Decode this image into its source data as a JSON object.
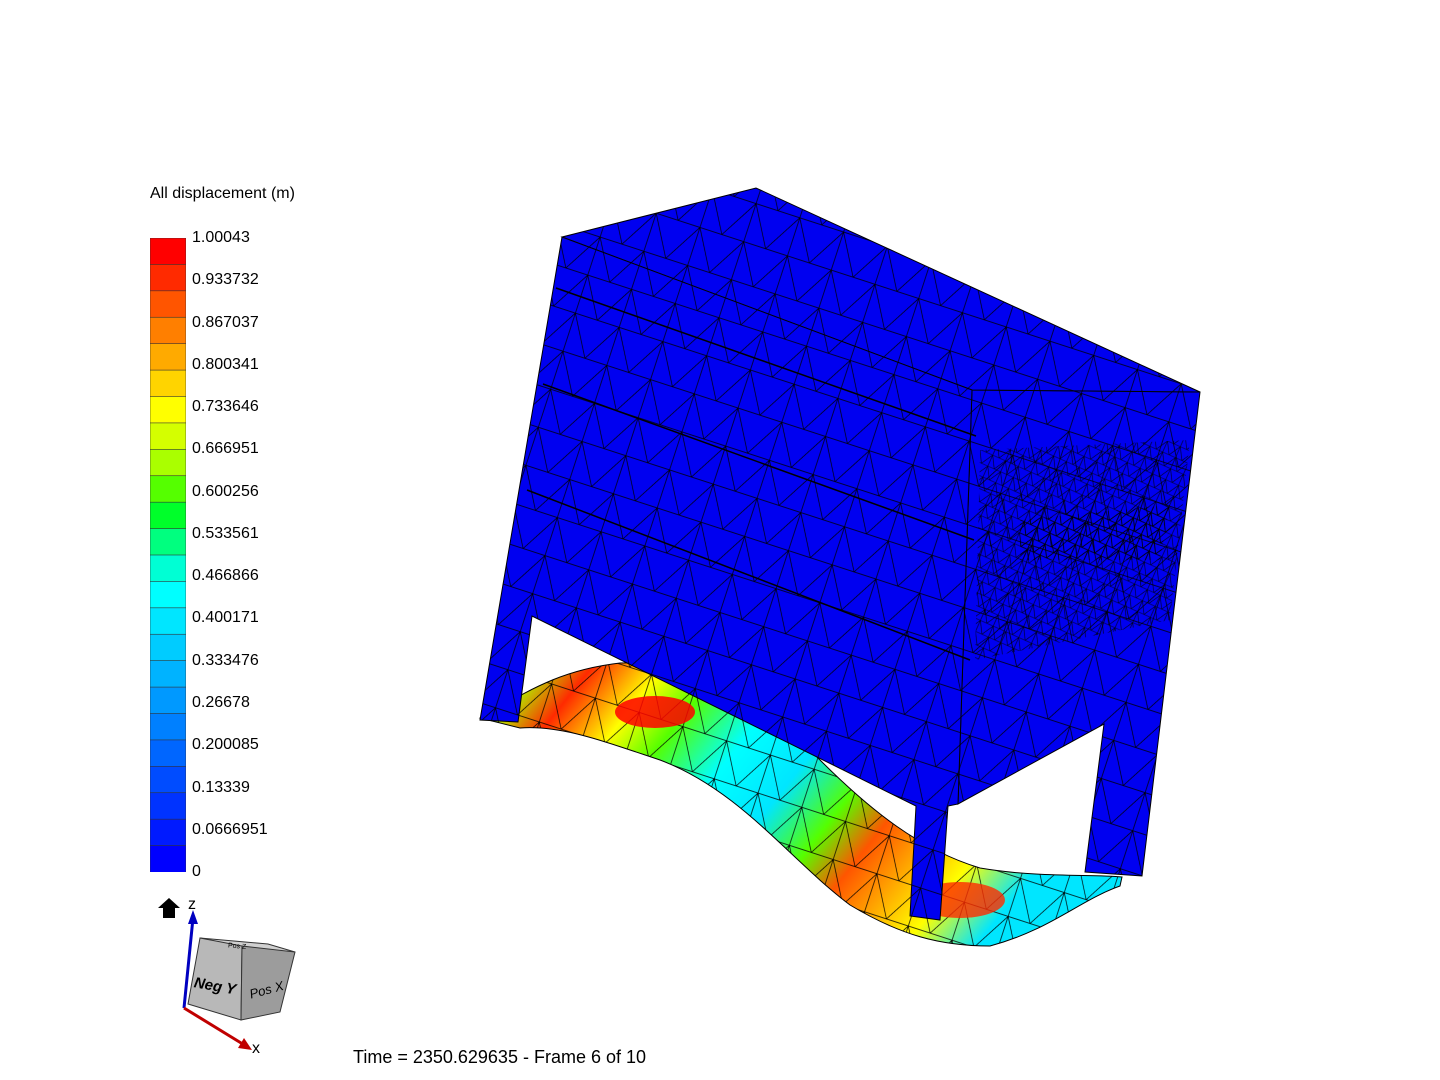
{
  "legend": {
    "title": "All displacement (m)",
    "ticks": [
      "1.00043",
      "0.933732",
      "0.867037",
      "0.800341",
      "0.733646",
      "0.666951",
      "0.600256",
      "0.533561",
      "0.466866",
      "0.400171",
      "0.333476",
      "0.26678",
      "0.200085",
      "0.13339",
      "0.0666951",
      "0"
    ],
    "band_colors": [
      "#ff0000",
      "#ff2a00",
      "#ff5500",
      "#ff7f00",
      "#ffaa00",
      "#ffd400",
      "#ffff00",
      "#d4ff00",
      "#aaff00",
      "#55ff00",
      "#00ff2a",
      "#00ff7f",
      "#00ffd4",
      "#00ffff",
      "#00e6ff",
      "#00ccff",
      "#00b3ff",
      "#0099ff",
      "#0080ff",
      "#0066ff",
      "#004cff",
      "#0033ff",
      "#001aff",
      "#0000ff"
    ]
  },
  "status": {
    "time_text": "Time = 2350.629635 - Frame 6 of 10"
  },
  "orientation": {
    "z_label": "z",
    "x_label": "x",
    "face_front": "Neg Y",
    "face_side": "Pos X",
    "face_top": "Pos Z"
  },
  "colors": {
    "mesh_blue": "#0000f0",
    "edge": "#000000",
    "axis_x": "#c00000",
    "axis_z": "#0000c0"
  }
}
